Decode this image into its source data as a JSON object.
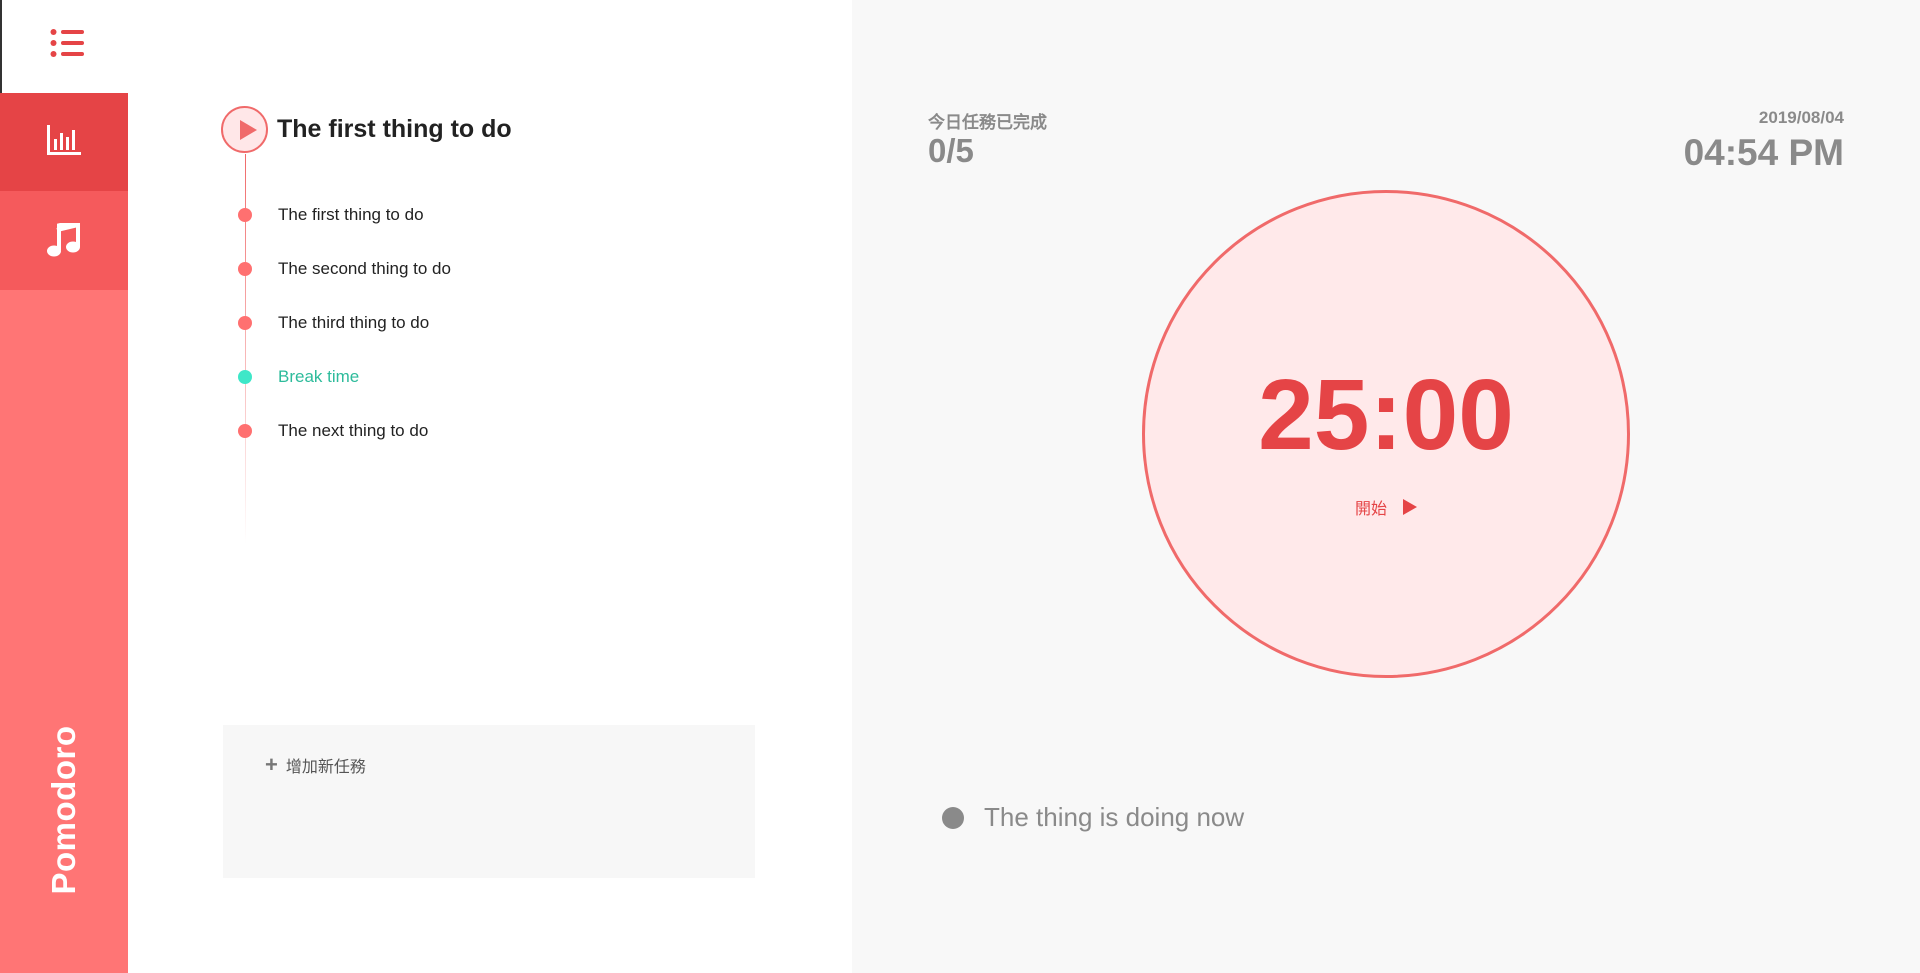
{
  "sidebar": {
    "brand": "Pomodoro",
    "icons": {
      "menu": "list-icon",
      "stats": "bar-chart-icon",
      "music": "music-note-icon"
    }
  },
  "current_task": {
    "title": "The first thing to do"
  },
  "tasks": [
    {
      "label": "The first thing to do",
      "type": "task"
    },
    {
      "label": "The second thing to do",
      "type": "task"
    },
    {
      "label": "The third thing to do",
      "type": "task"
    },
    {
      "label": "Break time",
      "type": "break"
    },
    {
      "label": "The next thing to do",
      "type": "task"
    }
  ],
  "add_task": {
    "label": "增加新任務",
    "icon": "plus-icon"
  },
  "status": {
    "progress_label": "今日任務已完成",
    "progress_value": "0/5",
    "date": "2019/08/04",
    "time": "04:54 PM"
  },
  "timer": {
    "countdown": "25:00",
    "start_label": "開始"
  },
  "now_doing": {
    "label": "The thing is doing now"
  },
  "colors": {
    "accent": "#e54446",
    "sidebar": "#ff7575",
    "break": "#3ee7c8",
    "muted": "#8a8a8a"
  }
}
